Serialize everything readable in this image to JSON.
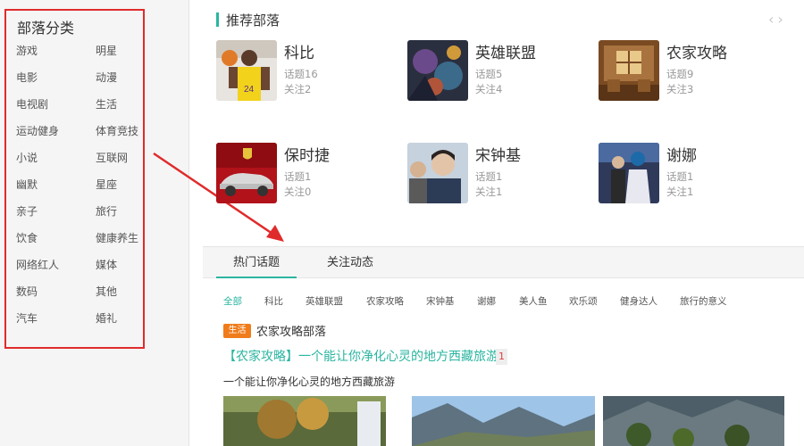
{
  "sidebar": {
    "title": "部落分类",
    "categories": [
      "游戏",
      "明星",
      "电影",
      "动漫",
      "电视剧",
      "生活",
      "运动健身",
      "体育竞技",
      "小说",
      "互联网",
      "幽默",
      "星座",
      "亲子",
      "旅行",
      "饮食",
      "健康养生",
      "网络红人",
      "媒体",
      "数码",
      "其他",
      "汽车",
      "婚礼"
    ]
  },
  "recommend": {
    "title": "推荐部落",
    "prev": "‹",
    "next": "›",
    "tribes": [
      {
        "name": "科比",
        "topics": "话题16",
        "follows": "关注2"
      },
      {
        "name": "英雄联盟",
        "topics": "话题5",
        "follows": "关注4"
      },
      {
        "name": "农家攻略",
        "topics": "话题9",
        "follows": "关注3"
      },
      {
        "name": "保时捷",
        "topics": "话题1",
        "follows": "关注0"
      },
      {
        "name": "宋钟基",
        "topics": "话题1",
        "follows": "关注1"
      },
      {
        "name": "谢娜",
        "topics": "话题1",
        "follows": "关注1"
      }
    ]
  },
  "tabs": [
    "热门话题",
    "关注动态"
  ],
  "filters": [
    "全部",
    "科比",
    "英雄联盟",
    "农家攻略",
    "宋钟基",
    "谢娜",
    "美人鱼",
    "欢乐颂",
    "健身达人",
    "旅行的意义"
  ],
  "post": {
    "tag": "生活",
    "tribe": "农家攻略部落",
    "title": "【农家攻略】一个能让你净化心灵的地方西藏旅游",
    "badge": "1",
    "desc": "一个能让你净化心灵的地方西藏旅游"
  },
  "colors": {
    "accent": "#2bb5a0",
    "highlight_box": "#e02b2b",
    "tag": "#f07b1a"
  }
}
